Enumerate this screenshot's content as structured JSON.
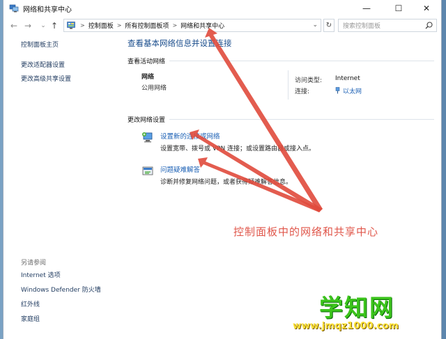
{
  "window": {
    "title": "网络和共享中心",
    "controls": {
      "minimize": "—",
      "maximize": "☐",
      "close": "✕"
    }
  },
  "nav": {
    "back": "←",
    "forward": "→",
    "up": "↑",
    "recent": "⌄"
  },
  "address": {
    "crumbs": [
      "控制面板",
      "所有控制面板项",
      "网络和共享中心"
    ],
    "search_placeholder": "搜索控制面板"
  },
  "sidebar": {
    "home": "控制面板主页",
    "items": [
      "更改适配器设置",
      "更改高级共享设置"
    ]
  },
  "see_also": {
    "heading": "另请参阅",
    "items": [
      "Internet 选项",
      "Windows Defender 防火墙",
      "红外线",
      "家庭组"
    ]
  },
  "main": {
    "title": "查看基本网络信息并设置连接",
    "active_networks_heading": "查看活动网络",
    "network_name": "网络",
    "network_type": "公用网络",
    "access_type_label": "访问类型:",
    "access_type_value": "Internet",
    "connections_label": "连接:",
    "connections_value": "以太网",
    "change_settings_heading": "更改网络设置",
    "tasks": [
      {
        "title": "设置新的连接或网络",
        "description": "设置宽带、拨号或 VPN 连接；或设置路由器或接入点。"
      },
      {
        "title": "问题疑难解答",
        "description": "诊断并修复网络问题，或者获得疑难解答信息。"
      }
    ]
  },
  "annotation": "控制面板中的网络和共享中心",
  "watermark": {
    "brand": "学知网",
    "url": "www.jmqz1000.com"
  },
  "colors": {
    "link": "#1a5fb4",
    "title": "#1a4d8c",
    "annotation": "#e0564a",
    "arrow": "#e04a3c"
  }
}
